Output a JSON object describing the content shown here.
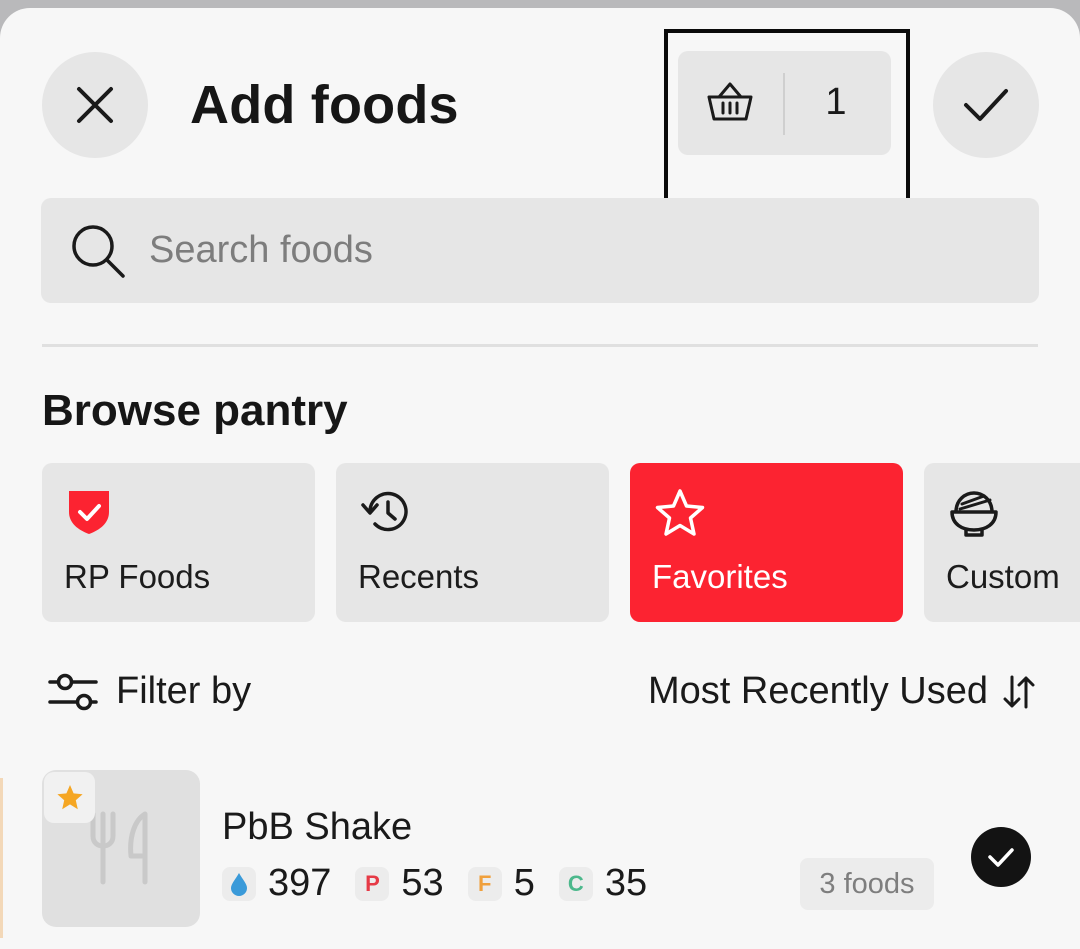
{
  "header": {
    "title": "Add foods",
    "close_icon": "close-icon",
    "confirm_icon": "checkmark-icon",
    "basket": {
      "icon": "basket-icon",
      "count": "1"
    }
  },
  "search": {
    "placeholder": "Search foods",
    "value": "",
    "icon": "search-icon"
  },
  "browse": {
    "title": "Browse pantry",
    "categories": [
      {
        "label": "RP Foods",
        "icon": "shield-check-icon",
        "active": false
      },
      {
        "label": "Recents",
        "icon": "history-icon",
        "active": false
      },
      {
        "label": "Favorites",
        "icon": "star-icon",
        "active": true
      },
      {
        "label": "Custom",
        "icon": "bowl-icon",
        "active": false
      }
    ]
  },
  "filter": {
    "label": "Filter by",
    "icon": "sliders-icon"
  },
  "sort": {
    "label": "Most Recently Used",
    "icon": "sort-arrows-icon"
  },
  "items": [
    {
      "name": "PbB Shake",
      "favorite": true,
      "selected": true,
      "calories": "397",
      "protein_letter": "P",
      "protein": "53",
      "fat_letter": "F",
      "fat": "5",
      "carbs_letter": "C",
      "carbs": "35",
      "foods_count": "3 foods"
    }
  ],
  "colors": {
    "accent": "#fc2331",
    "calories": "#3a9ad9",
    "protein": "#e63a46",
    "fat": "#f0a03c",
    "carbs": "#4cb88c",
    "star": "#f5a623"
  }
}
